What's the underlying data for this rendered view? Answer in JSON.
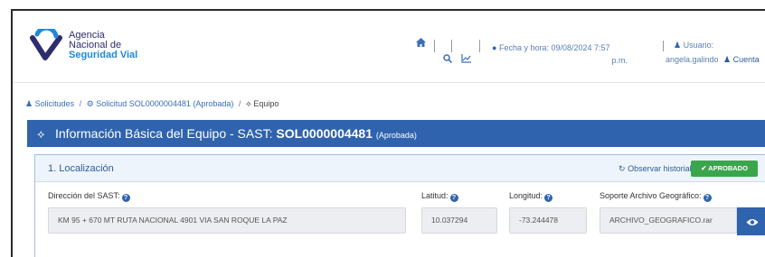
{
  "agency": {
    "line1": "Agencia",
    "line2": "Nacional de",
    "line3": "Seguridad Vial"
  },
  "header": {
    "fecha_label": "Fecha y hora: 09/08/2024 7:57",
    "fecha_suffix": "p.m.",
    "usuario_label": "Usuario:",
    "usuario_name": "angela.galindo",
    "cuenta_label": "Cuenta"
  },
  "breadcrumb": {
    "item1": "Solicitudes",
    "item2": "Solicitud SOL0000004481 (Aprobada)",
    "item3": "Equipo"
  },
  "title_bar": {
    "prefix": "Información Básica del Equipo - SAST:",
    "code": "SOL0000004481",
    "status": "(Aprobada)"
  },
  "panel": {
    "title": "1. Localización",
    "historial_label": "Observar historial",
    "aprobado_label": "✔ APROBADO",
    "fields": {
      "direccion_label": "Dirección del SAST:",
      "direccion_value": "KM 95 + 670 MT RUTA NACIONAL 4901 VIA SAN ROQUE LA PAZ",
      "latitud_label": "Latitud:",
      "latitud_value": "10.037294",
      "longitud_label": "Longitud:",
      "longitud_value": "-73.244478",
      "soporte_label": "Soporte Archivo Geográfico:",
      "soporte_value": "ARCHIVO_GEOGRAFICO.rar"
    }
  },
  "icons": {
    "home": "home-icon",
    "search": "search-icon",
    "chart": "chart-icon",
    "clock": "clock-icon",
    "user": "user-icon",
    "users": "users-icon",
    "eye": "eye-icon"
  },
  "colors": {
    "primary": "#2f63ad",
    "success": "#3aa64b",
    "navy": "#2d2d6e",
    "cyan": "#1e88d6"
  }
}
